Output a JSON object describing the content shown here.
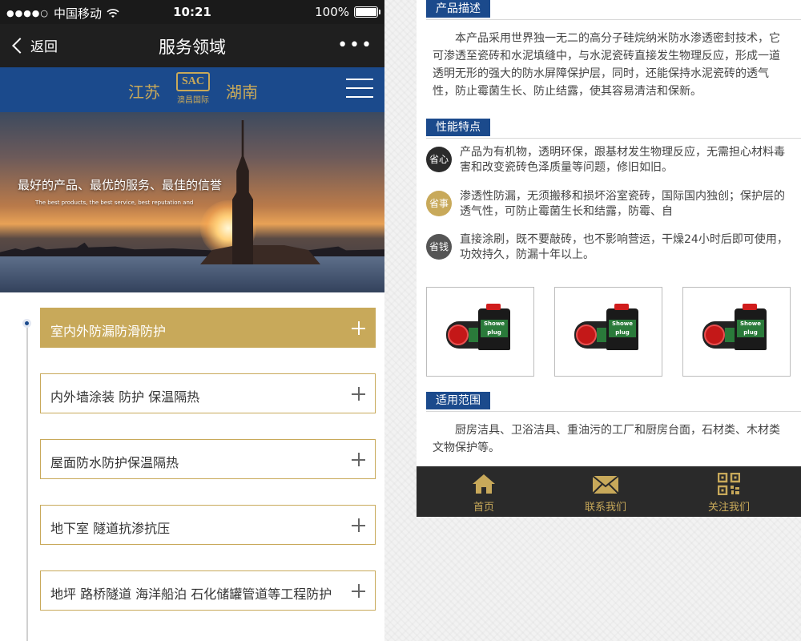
{
  "status_bar": {
    "signal": "●●●●○",
    "carrier": "中国移动",
    "wifi": "wifi-icon",
    "time": "10:21",
    "battery": "100%"
  },
  "nav": {
    "back_label": "返回",
    "title": "服务领域",
    "more": "•••"
  },
  "brand": {
    "left_city": "江苏",
    "right_city": "湖南",
    "logo_text": "SAC",
    "logo_sub": "澳昌国际",
    "accent": "#c8a95a",
    "primary": "#1b4a8c"
  },
  "hero": {
    "headline": "最好的产品、最优的服务、最佳的信誉",
    "subline": "The best products, the best service, best reputation and"
  },
  "services": [
    {
      "label": "室内外防漏防滑防护",
      "active": true
    },
    {
      "label": "内外墙涂装 防护 保温隔热",
      "active": false
    },
    {
      "label": "屋面防水防护保温隔热",
      "active": false
    },
    {
      "label": "地下室  隧道抗渗抗压",
      "active": false
    },
    {
      "label": "地坪 路桥隧道 海洋船泊 石化储罐管道等工程防护",
      "active": false
    }
  ],
  "detail": {
    "desc_title": "产品描述",
    "desc_text": "本产品采用世界独一无二的高分子硅烷纳米防水渗透密封技术，它可渗透至瓷砖和水泥填缝中，与水泥瓷砖直接发生物理反应，形成一道透明无形的强大的防水屏障保护层，同时，还能保持水泥瓷砖的透气性，防止霉菌生长、防止结露，使其容易清洁和保新。",
    "features_title": "性能特点",
    "features": [
      {
        "badge": "省心",
        "color": "#2b2b2b",
        "text": "产品为有机物，透明环保，跟基材发生物理反应，无需担心材料毒害和改变瓷砖色泽质量等问题，修旧如旧。"
      },
      {
        "badge": "省事",
        "color": "#c8a95a",
        "text": "渗透性防漏，无须搬移和损坏浴室瓷砖，国际国内独创；保护层的透气性，可防止霉菌生长和结露，防霉、自"
      },
      {
        "badge": "省钱",
        "color": "#555555",
        "text": "直接涂刷，既不要敲砖，也不影响营运，干燥24小时后即可使用，功效持久，防漏十年以上。"
      }
    ],
    "product_label": "Showe plug",
    "scope_title": "适用范围",
    "scope_text": "厨房洁具、卫浴洁具、重油污的工厂和厨房台面，石材类、木材类文物保护等。"
  },
  "tabbar": [
    {
      "label": "首页",
      "icon": "home-icon"
    },
    {
      "label": "联系我们",
      "icon": "mail-icon"
    },
    {
      "label": "关注我们",
      "icon": "qrcode-icon"
    }
  ]
}
